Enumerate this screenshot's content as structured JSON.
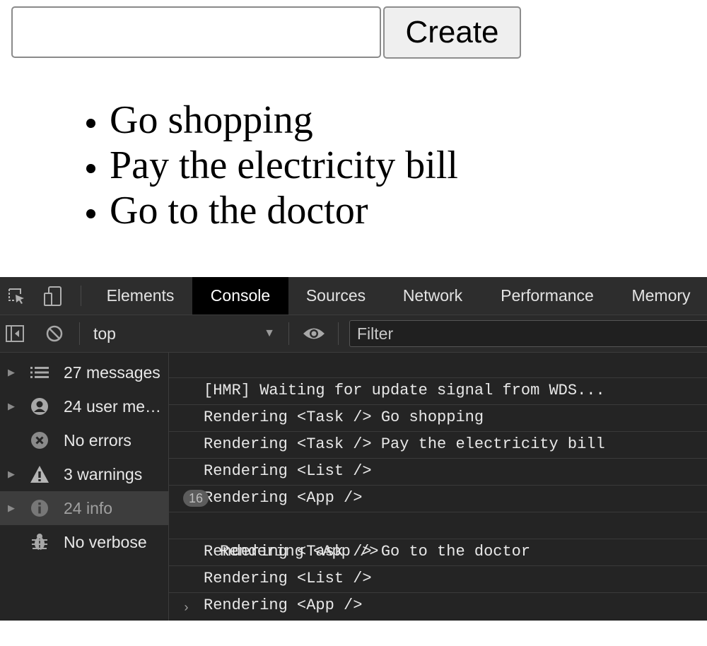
{
  "app": {
    "input": {
      "value": "",
      "placeholder": ""
    },
    "create_label": "Create",
    "tasks": [
      "Go shopping",
      "Pay the electricity bill",
      "Go to the doctor"
    ]
  },
  "devtools": {
    "tabs": [
      "Elements",
      "Console",
      "Sources",
      "Network",
      "Performance",
      "Memory"
    ],
    "active_tab": "Console",
    "context": "top",
    "filter_placeholder": "Filter",
    "sidebar": [
      {
        "label": "27 messages",
        "icon": "list-icon",
        "expandable": true
      },
      {
        "label": "24 user me…",
        "icon": "user-icon",
        "expandable": true
      },
      {
        "label": "No errors",
        "icon": "error-icon",
        "expandable": false
      },
      {
        "label": "3 warnings",
        "icon": "warning-icon",
        "expandable": true
      },
      {
        "label": "24 info",
        "icon": "info-icon",
        "expandable": true,
        "selected": true
      },
      {
        "label": "No verbose",
        "icon": "bug-icon",
        "expandable": false
      }
    ],
    "messages": [
      {
        "text": "[HMR] Waiting for update signal from WDS..."
      },
      {
        "text": "Rendering <Task /> Go shopping"
      },
      {
        "text": "Rendering <Task /> Pay the electricity bill"
      },
      {
        "text": "Rendering <List />"
      },
      {
        "text": "Rendering <App />"
      },
      {
        "text": "Rendering <App />",
        "count": "16"
      },
      {
        "text": "Rendering <Task /> Go to the doctor"
      },
      {
        "text": "Rendering <List />"
      },
      {
        "text": "Rendering <App />"
      }
    ],
    "prompt_symbol": "›"
  }
}
